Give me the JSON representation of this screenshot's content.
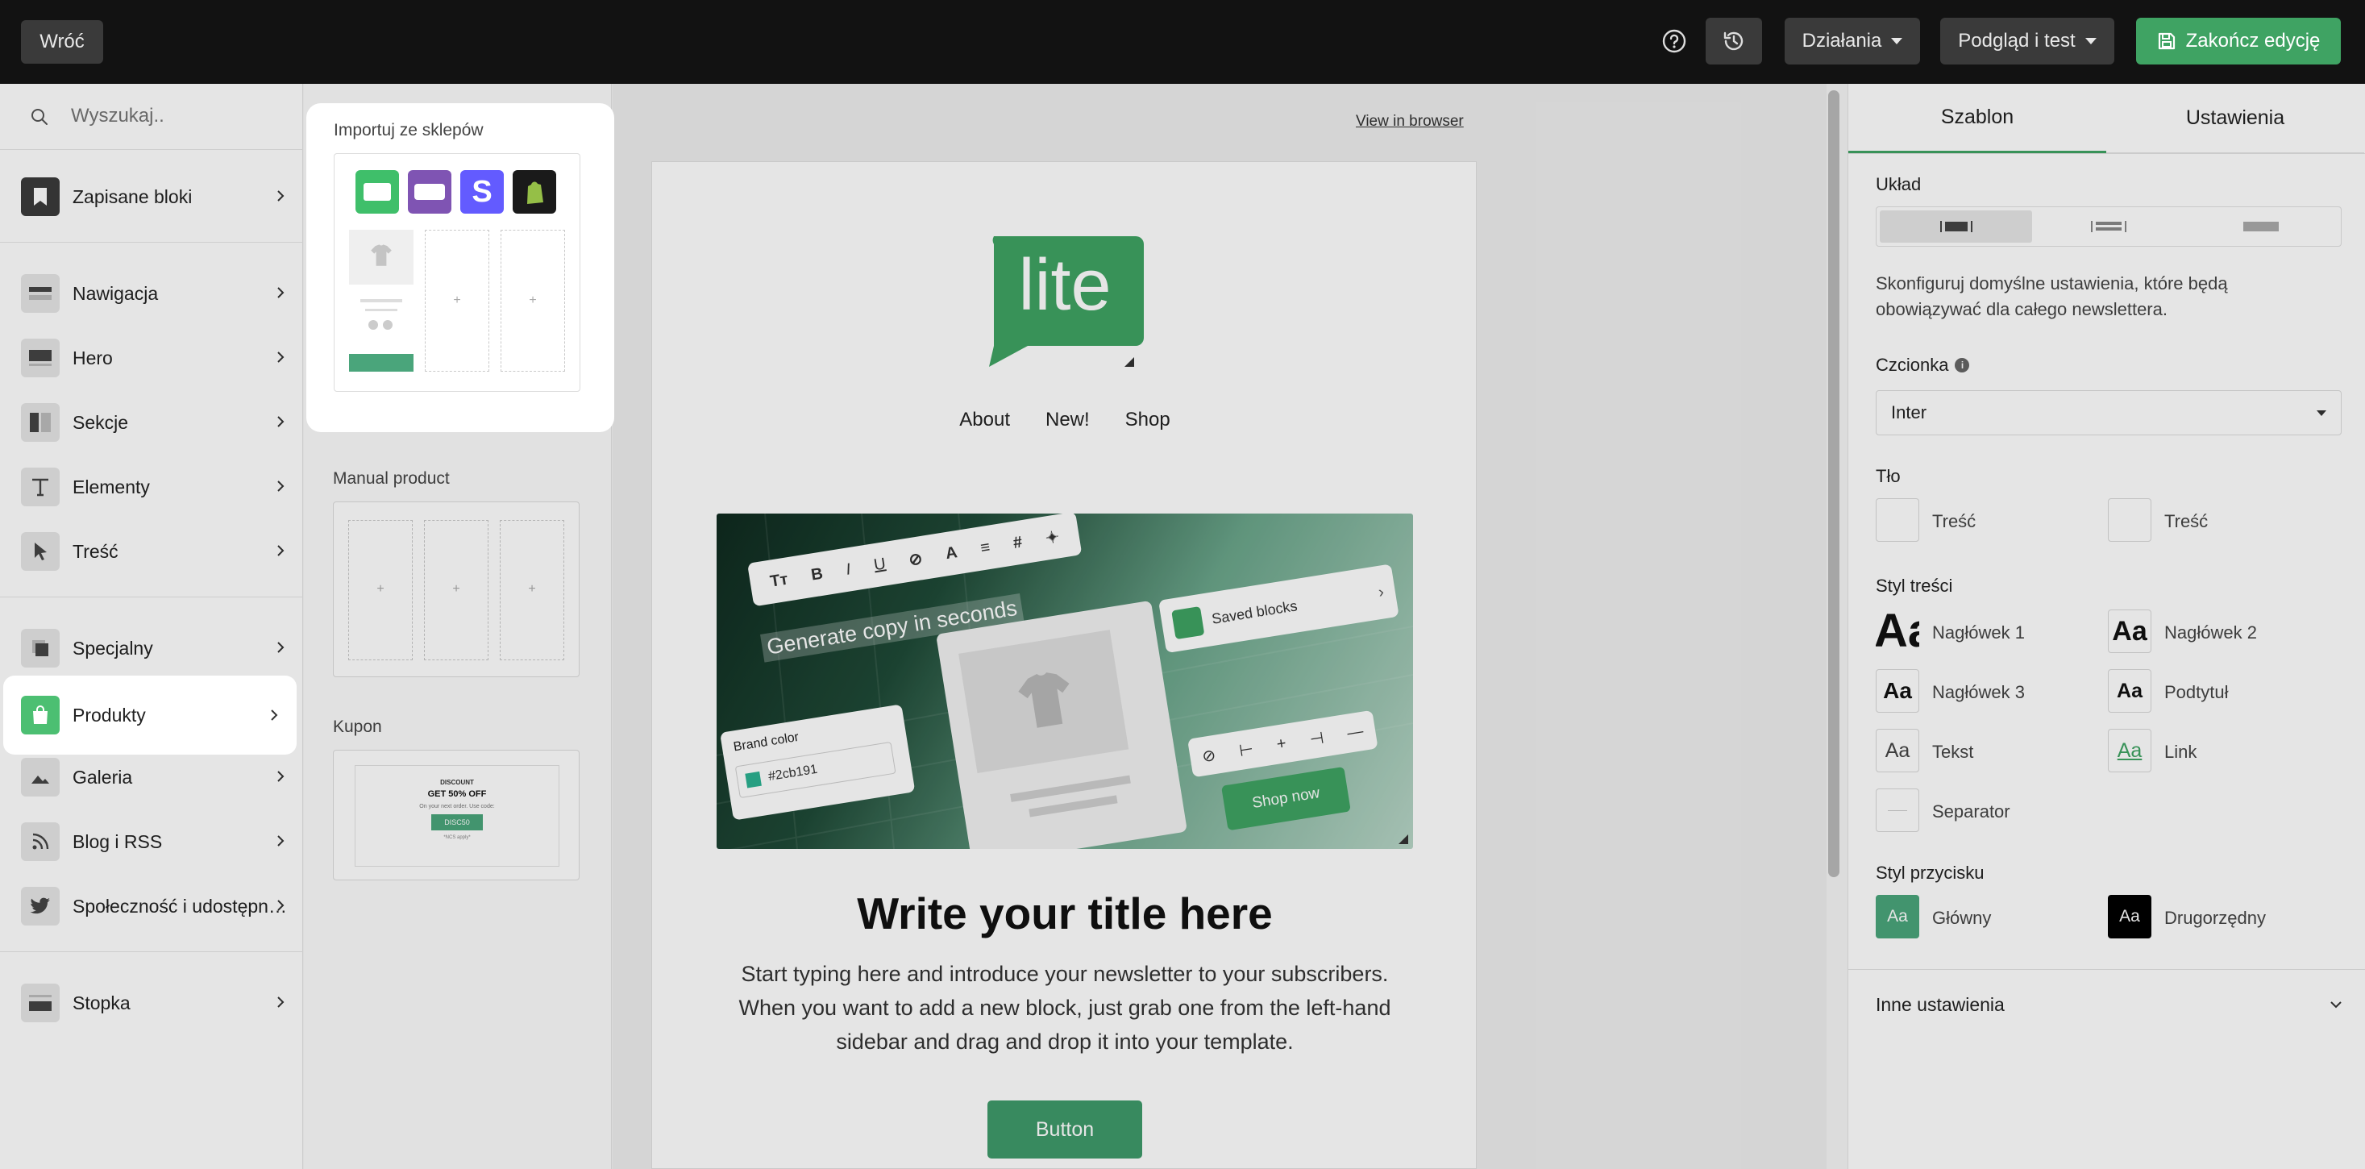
{
  "topbar": {
    "back_label": "Wróć",
    "actions_label": "Działania",
    "preview_label": "Podgląd i test",
    "finish_label": "Zakończ edycję"
  },
  "sidebar": {
    "search_placeholder": "Wyszukaj..",
    "items": [
      {
        "label": "Zapisane bloki",
        "icon": "bookmark-icon"
      },
      {
        "label": "Nawigacja",
        "icon": "navigation-icon"
      },
      {
        "label": "Hero",
        "icon": "hero-icon"
      },
      {
        "label": "Sekcje",
        "icon": "sections-icon"
      },
      {
        "label": "Elementy",
        "icon": "text-element-icon"
      },
      {
        "label": "Treść",
        "icon": "cursor-icon"
      },
      {
        "label": "Specjalny",
        "icon": "special-icon"
      },
      {
        "label": "Produkty",
        "icon": "shopping-bag-icon"
      },
      {
        "label": "Galeria",
        "icon": "image-icon"
      },
      {
        "label": "Blog i RSS",
        "icon": "rss-icon"
      },
      {
        "label": "Społeczność i udostępnianie",
        "icon": "twitter-icon"
      },
      {
        "label": "Stopka",
        "icon": "footer-icon"
      }
    ]
  },
  "blocks": {
    "import_title": "Importuj ze sklepów",
    "manual_title": "Manual product",
    "coupon_title": "Kupon",
    "coupon": {
      "kicker": "DISCOUNT",
      "headline": "GET 50% OFF",
      "sub": "On your next order. Use code:",
      "code": "DISC50",
      "fine": "*NCS apply*"
    }
  },
  "email": {
    "view_in_browser": "View in browser",
    "logo_text": "lite",
    "nav": [
      "About",
      "New!",
      "Shop"
    ],
    "hero": {
      "generate_text": "Generate copy in seconds",
      "saved_blocks": "Saved blocks",
      "brand_color_label": "Brand color",
      "brand_color_value": "#2cb191",
      "shop_now": "Shop now"
    },
    "title": "Write your title here",
    "body": "Start typing here and introduce your newsletter to your subscribers. When you want to add a new block, just grab one from the left-hand sidebar and drag and drop it into your template.",
    "button_label": "Button"
  },
  "right_panel": {
    "tabs": [
      "Szablon",
      "Ustawienia"
    ],
    "layout_label": "Układ",
    "description": "Skonfiguruj domyślne ustawienia, które będą obowiązywać dla całego newslettera.",
    "font_label": "Czcionka",
    "font_value": "Inter",
    "bg_label": "Tło",
    "bg_items": [
      "Treść",
      "Treść"
    ],
    "content_style_label": "Styl treści",
    "styles": [
      {
        "sample": "Aa",
        "label": "Nagłówek 1"
      },
      {
        "sample": "Aa",
        "label": "Nagłówek 2"
      },
      {
        "sample": "Aa",
        "label": "Nagłówek 3"
      },
      {
        "sample": "Aa",
        "label": "Podtytuł"
      },
      {
        "sample": "Aa",
        "label": "Tekst"
      },
      {
        "sample": "Aa",
        "label": "Link"
      },
      {
        "sample": "",
        "label": "Separator"
      }
    ],
    "button_style_label": "Styl przycisku",
    "buttons": [
      {
        "sample": "Aa",
        "label": "Główny"
      },
      {
        "sample": "Aa",
        "label": "Drugorzędny"
      }
    ],
    "other_settings": "Inne ustawienia"
  },
  "colors": {
    "brand_green": "#4aa57b",
    "finish_green": "#3fa363",
    "topbar": "#121212"
  }
}
